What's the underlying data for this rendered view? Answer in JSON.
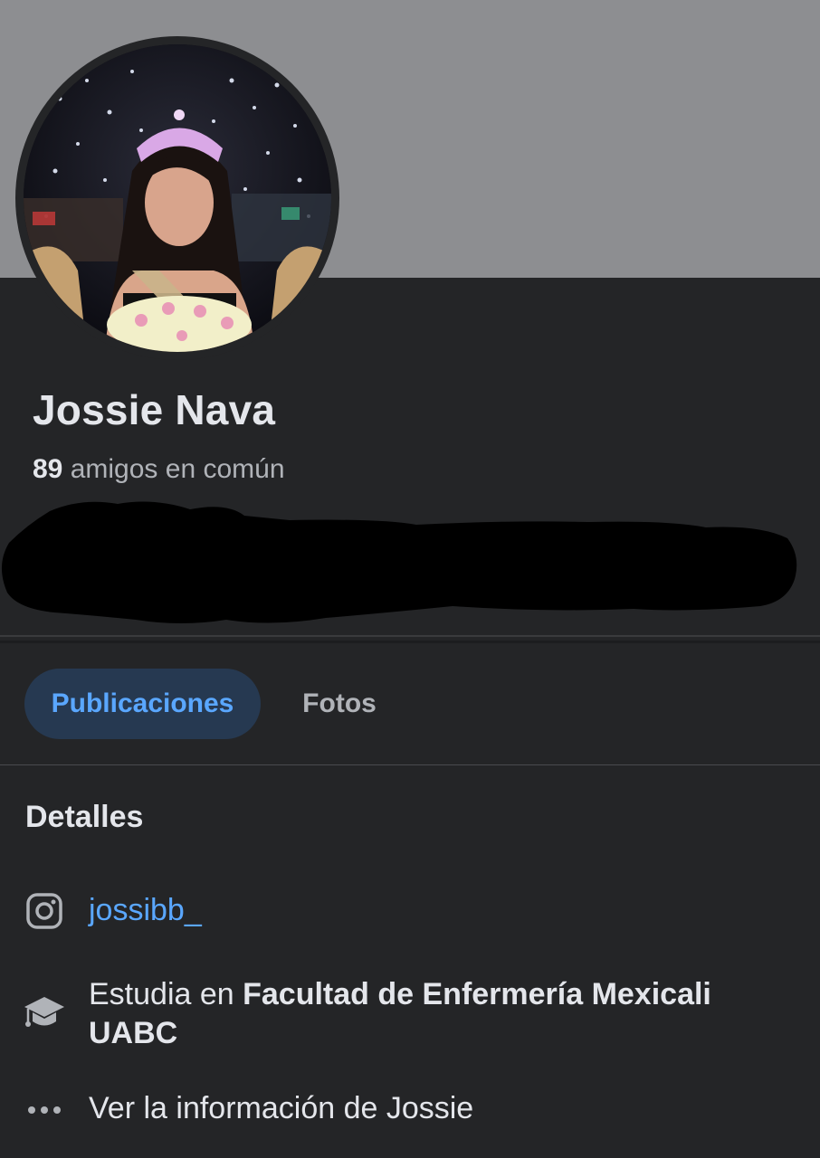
{
  "profile": {
    "name": "Jossie Nava",
    "mutual_count": "89",
    "mutual_label": "amigos en común"
  },
  "tabs": [
    {
      "label": "Publicaciones",
      "active": true
    },
    {
      "label": "Fotos",
      "active": false
    }
  ],
  "details": {
    "title": "Detalles",
    "instagram": {
      "icon": "instagram-icon",
      "handle": "jossibb_"
    },
    "education": {
      "icon": "graduation-cap-icon",
      "prefix": "Estudia en",
      "school": "Facultad de Enfermería Mexicali UABC"
    },
    "more": {
      "icon": "more-dots-icon",
      "label": "Ver la información de Jossie"
    }
  },
  "colors": {
    "background": "#242527",
    "cover": "#8d8e91",
    "accent": "#5aa7ff",
    "active_tab_bg": "#263951",
    "primary_text": "#e4e6eb",
    "secondary_text": "#b0b3b8"
  }
}
